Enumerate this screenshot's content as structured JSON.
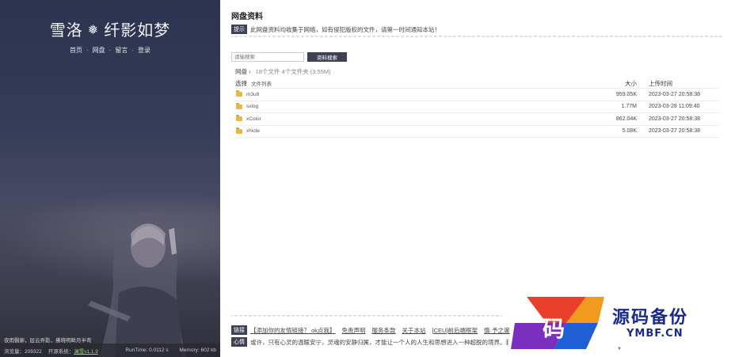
{
  "sidebar": {
    "title_left": "雪洛",
    "title_right": "纤影如梦",
    "nav": [
      "首页",
      "网盘",
      "留言",
      "登录"
    ],
    "motto": "夜雨翳廊，层云弄影，拂晓明眸月半弯",
    "footer": {
      "views": "浏览量：209322",
      "system_label": "开源系统：",
      "system_link": "澜雪v1.1.9",
      "runtime": "RunTime: 0.0112 s",
      "memory": "Memory: 602 kb"
    }
  },
  "main": {
    "page_title": "网盘资料",
    "notice_tag": "提示",
    "notice_text": "此网盘资料均收集于网络，如有侵犯版权的文件，请第一时间通知本站！",
    "search": {
      "placeholder": "请输搜索",
      "button": "资料搜索"
    },
    "breadcrumb": {
      "root": "网盘 ›",
      "meta": "18个文件 4个文件夹 (3.55M)"
    },
    "table": {
      "headers": {
        "select": "选择",
        "list": "文件列表",
        "size": "大小",
        "time": "上传时间"
      },
      "rows": [
        {
          "name": "m3u8",
          "size": "959.05K",
          "time": "2023-03-27 20:58:38"
        },
        {
          "name": "sxlog",
          "size": "1.77M",
          "time": "2023-03-28 11:09:40"
        },
        {
          "name": "xColor",
          "size": "862.04K",
          "time": "2023-03-27 20:58:38"
        },
        {
          "name": "xNote",
          "size": "5.08K",
          "time": "2023-03-27 20:58:38"
        }
      ]
    },
    "links": {
      "tag": "链接",
      "items": [
        "【添加你的友情链接？ ok点我】",
        "免责声明",
        "服务条款",
        "关于本站",
        "[CEU]前后端框架",
        "慎·予之邃"
      ]
    },
    "mood": {
      "tag": "心情",
      "text": "或许，只有心灵的温暖安宁，灵魂的安静归属，才能让一个人的人生和思想进入一种超脱的境界。我"
    }
  },
  "watermark": {
    "cn": "源码备份",
    "en": "YMBF.CN",
    "glyph": "码"
  },
  "colors": {
    "accent": "#3d4153",
    "folder": "#e8b74a",
    "watermark_blue": "#1a2a8c"
  }
}
